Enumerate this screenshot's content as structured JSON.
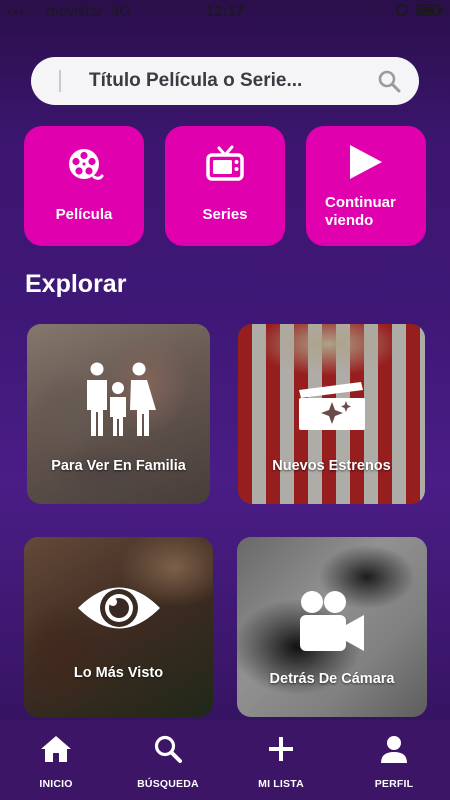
{
  "status_bar": {
    "carrier": "movistar",
    "network": "4G",
    "time": "12:17"
  },
  "search": {
    "placeholder": "Título Película o Serie..."
  },
  "categories": [
    {
      "label": "Película",
      "icon": "film-reel-icon"
    },
    {
      "label": "Series",
      "icon": "tv-icon"
    },
    {
      "label_line1": "Continuar",
      "label_line2": "viendo",
      "icon": "play-icon"
    }
  ],
  "explore": {
    "title": "Explorar",
    "tiles": [
      {
        "label": "Para Ver En Familia",
        "icon": "family-icon"
      },
      {
        "label": "Nuevos Estrenos",
        "icon": "clapperboard-icon"
      },
      {
        "label": "Lo Más Visto",
        "icon": "eye-icon"
      },
      {
        "label": "Detrás De Cámara",
        "icon": "video-camera-icon"
      }
    ]
  },
  "bottom_nav": [
    {
      "label": "INICIO",
      "icon": "home-icon"
    },
    {
      "label": "BÚSQUEDA",
      "icon": "search-icon"
    },
    {
      "label": "MI LISTA",
      "icon": "plus-icon"
    },
    {
      "label": "PERFIL",
      "icon": "person-icon"
    }
  ],
  "colors": {
    "accent": "#e100ad",
    "background": "#3f1877",
    "nav_background": "#3c1566"
  }
}
